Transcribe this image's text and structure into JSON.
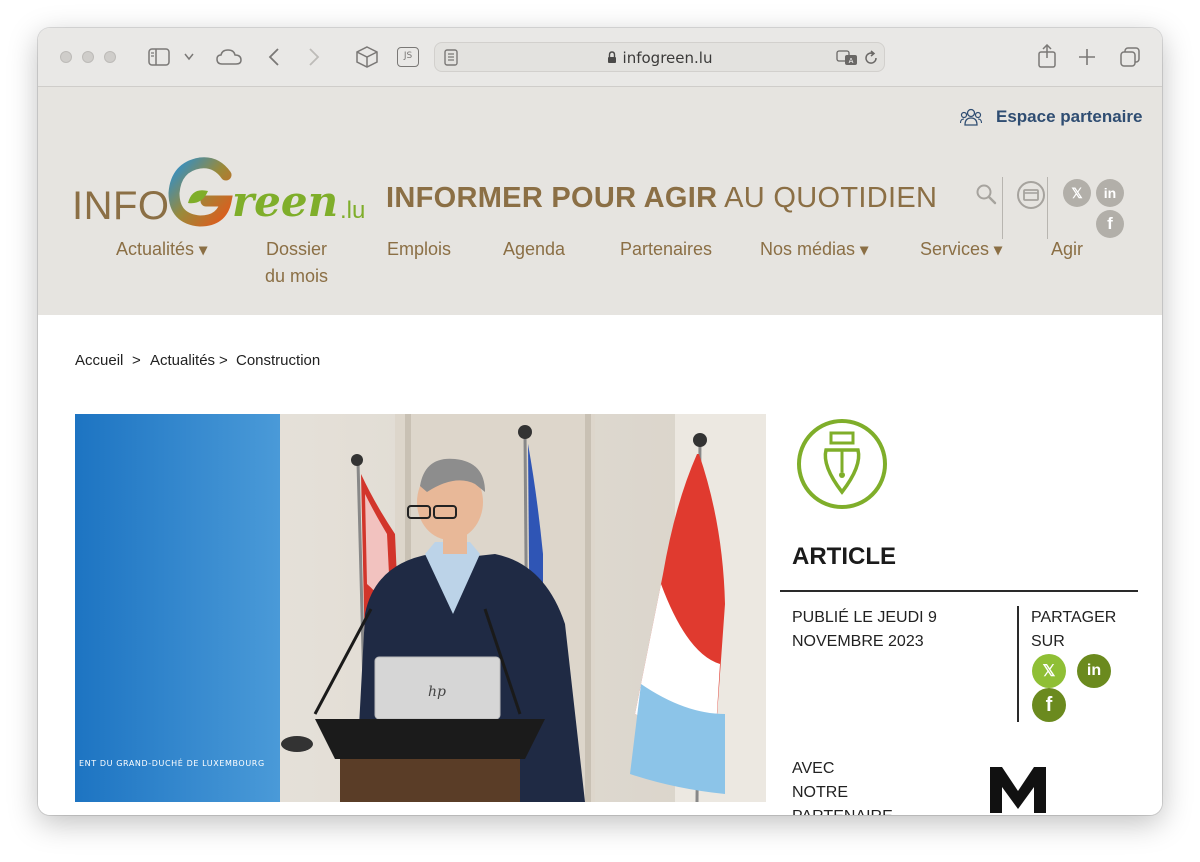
{
  "browser": {
    "url": "infogreen.lu",
    "js_badge": "JS"
  },
  "header": {
    "partner_space": "Espace partenaire",
    "logo_prefix": "INFO",
    "logo_main": "Green",
    "logo_suffix": ".lu",
    "tagline_bold": "INFORMER POUR AGIR",
    "tagline_rest": "AU QUOTIDIEN",
    "nav": [
      {
        "label": "Actualités",
        "dropdown": true
      },
      {
        "label": "Dossier du mois",
        "dropdown": false
      },
      {
        "label": "Emplois",
        "dropdown": false
      },
      {
        "label": "Agenda",
        "dropdown": false
      },
      {
        "label": "Partenaires",
        "dropdown": false
      },
      {
        "label": "Nos médias",
        "dropdown": true
      },
      {
        "label": "Services",
        "dropdown": true
      },
      {
        "label": "Agir",
        "dropdown": false
      }
    ],
    "nav_line1_dossier": "Dossier",
    "nav_line2_dossier": "du mois"
  },
  "breadcrumb": {
    "items": [
      "Accueil",
      "Actualités",
      "Construction"
    ],
    "separator": ">"
  },
  "photo": {
    "banner_text": "ENT DU GRAND-DUCHÉ DE LUXEMBOURG",
    "laptop_logo": "hp"
  },
  "article": {
    "type_label": "ARTICLE",
    "published_line1": "PUBLIÉ LE JEUDI 9",
    "published_line2": "NOVEMBRE 2023",
    "share_line1": "PARTAGER",
    "share_line2": "SUR",
    "partner_line1": "AVEC",
    "partner_line2": "NOTRE",
    "partner_line3": "PARTENAIRE",
    "partner_logo_letter": "M"
  },
  "colors": {
    "accent_green": "#7fae2a",
    "olive_green": "#6b8a1e",
    "brown": "#8b6f45",
    "navy": "#2f4d72",
    "header_bg": "#e6e4e0"
  }
}
